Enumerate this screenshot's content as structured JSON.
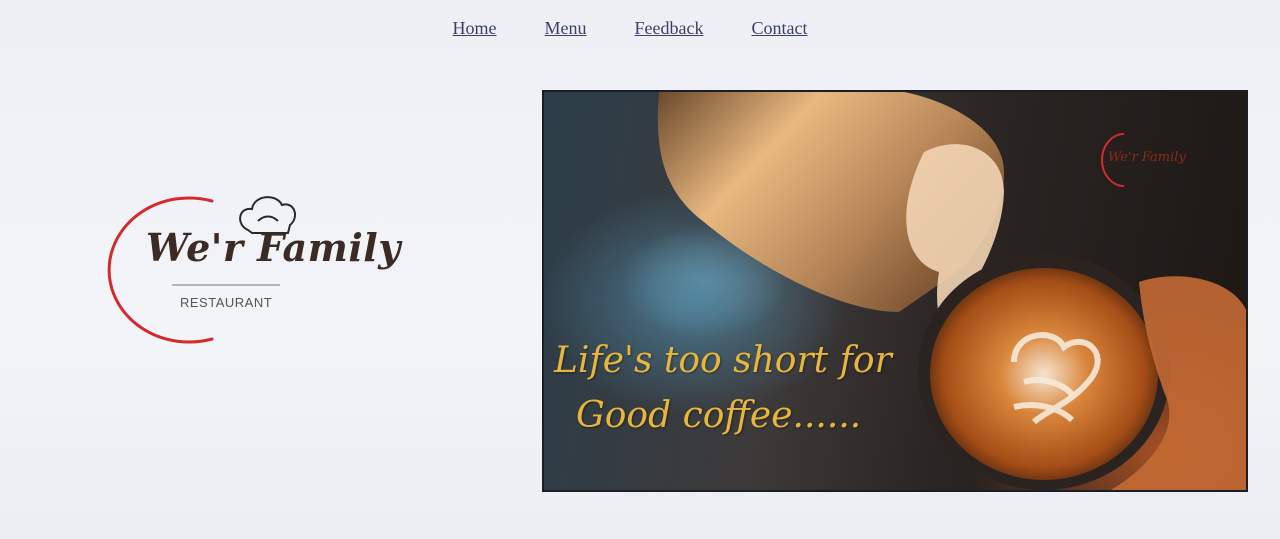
{
  "nav": {
    "items": [
      {
        "label": "Home"
      },
      {
        "label": "Menu"
      },
      {
        "label": "Feedback"
      },
      {
        "label": "Contact"
      }
    ]
  },
  "logo": {
    "name": "We'r Family",
    "subtitle": "RESTAURANT",
    "icon": "chef-hat-icon",
    "accent_color": "#d42a2a"
  },
  "hero": {
    "tagline_line1": "Life's too short for",
    "tagline_line2": "Good coffee......",
    "tagline_color": "#e7b63b",
    "watermark_name": "We'r Family"
  }
}
